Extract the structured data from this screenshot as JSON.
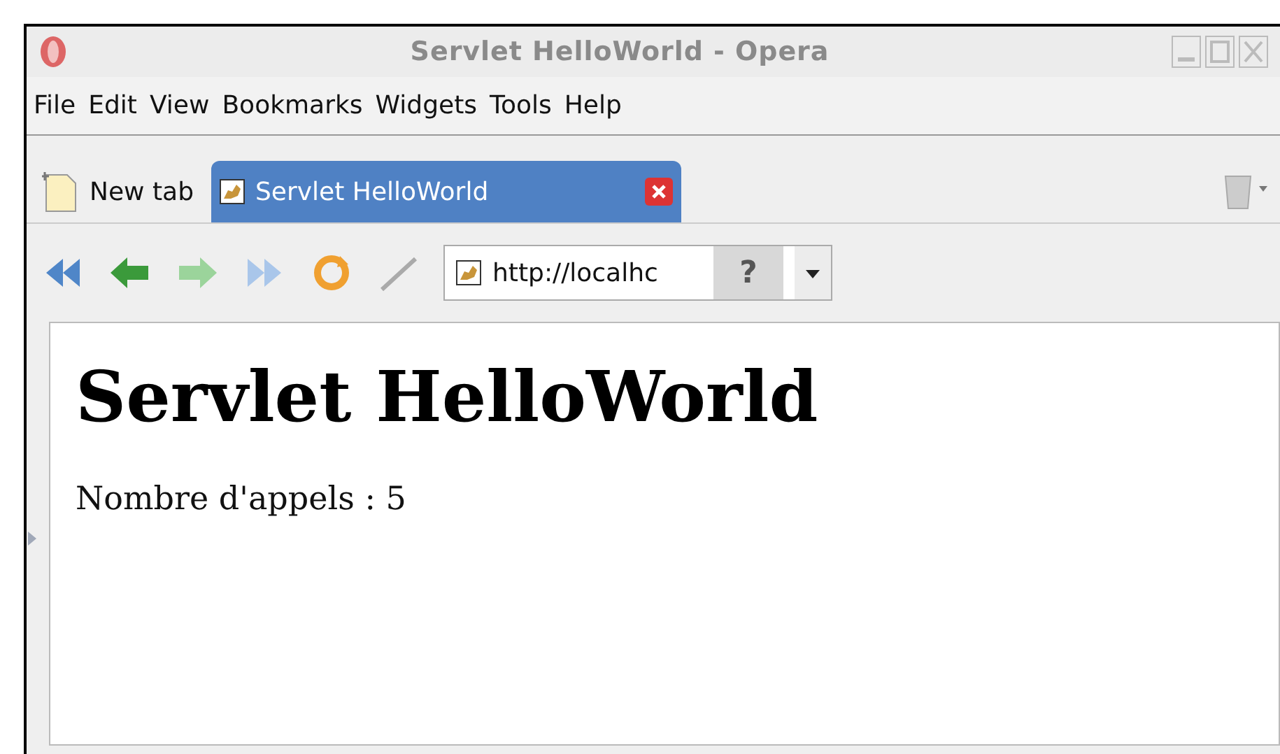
{
  "window": {
    "title": "Servlet HelloWorld - Opera"
  },
  "menu": [
    {
      "label": "File"
    },
    {
      "label": "Edit"
    },
    {
      "label": "View"
    },
    {
      "label": "Bookmarks"
    },
    {
      "label": "Widgets"
    },
    {
      "label": "Tools"
    },
    {
      "label": "Help"
    }
  ],
  "tabs": [
    {
      "label": "New tab",
      "kind": "new",
      "selected": false
    },
    {
      "label": "Servlet HelloWorld",
      "kind": "page",
      "selected": true
    }
  ],
  "address": {
    "value": "http://localhc",
    "security": "?"
  },
  "page": {
    "heading": "Servlet HelloWorld",
    "text": "Nombre d'appels : 5"
  }
}
